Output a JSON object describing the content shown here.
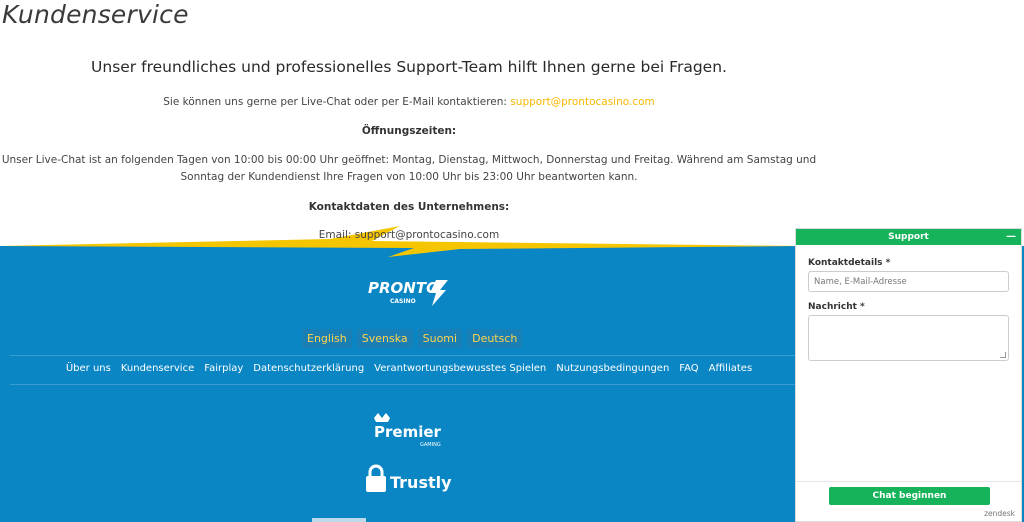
{
  "page": {
    "title": "Kundenservice",
    "subtitle": "Unser freundliches und professionelles Support-Team hilft Ihnen gerne bei Fragen.",
    "contact_prefix": "Sie können uns gerne per Live-Chat oder per E-Mail kontaktieren:",
    "contact_email": "support@prontocasino.com",
    "hours_heading": "Öffnungszeiten:",
    "hours_line1": "Unser Live-Chat ist an folgenden Tagen von 10:00 bis 00:00 Uhr geöffnet: Montag, Dienstag, Mittwoch, Donnerstag und Freitag. Während am Samstag und",
    "hours_line2": "Sonntag der Kundendienst Ihre Fragen von 10:00 Uhr bis 23:00 Uhr beantworten kann.",
    "company_heading": "Kontaktdaten des Unternehmens:",
    "company_email": "Email: support@prontocasino.com"
  },
  "footer": {
    "logo_text": "PRONTO",
    "logo_sub": "CASINO",
    "languages": [
      "English",
      "Svenska",
      "Suomi",
      "Deutsch"
    ],
    "nav": [
      "Über uns",
      "Kundenservice",
      "Fairplay",
      "Datenschutzerklärung",
      "Verantwortungsbewusstes Spielen",
      "Nutzungsbedingungen",
      "FAQ",
      "Affiliates"
    ],
    "premier_text": "Premier",
    "premier_sub": "GAMING",
    "trustly_text": "Trustly"
  },
  "widget": {
    "title": "Support",
    "minimize": "—",
    "contact_label": "Kontaktdetails *",
    "contact_placeholder": "Name, E-Mail-Adresse",
    "message_label": "Nachricht *",
    "button": "Chat beginnen",
    "brand": "zendesk"
  },
  "colors": {
    "footer_blue": "#0a86c5",
    "accent_yellow": "#f5b800",
    "widget_green": "#17b35a"
  }
}
